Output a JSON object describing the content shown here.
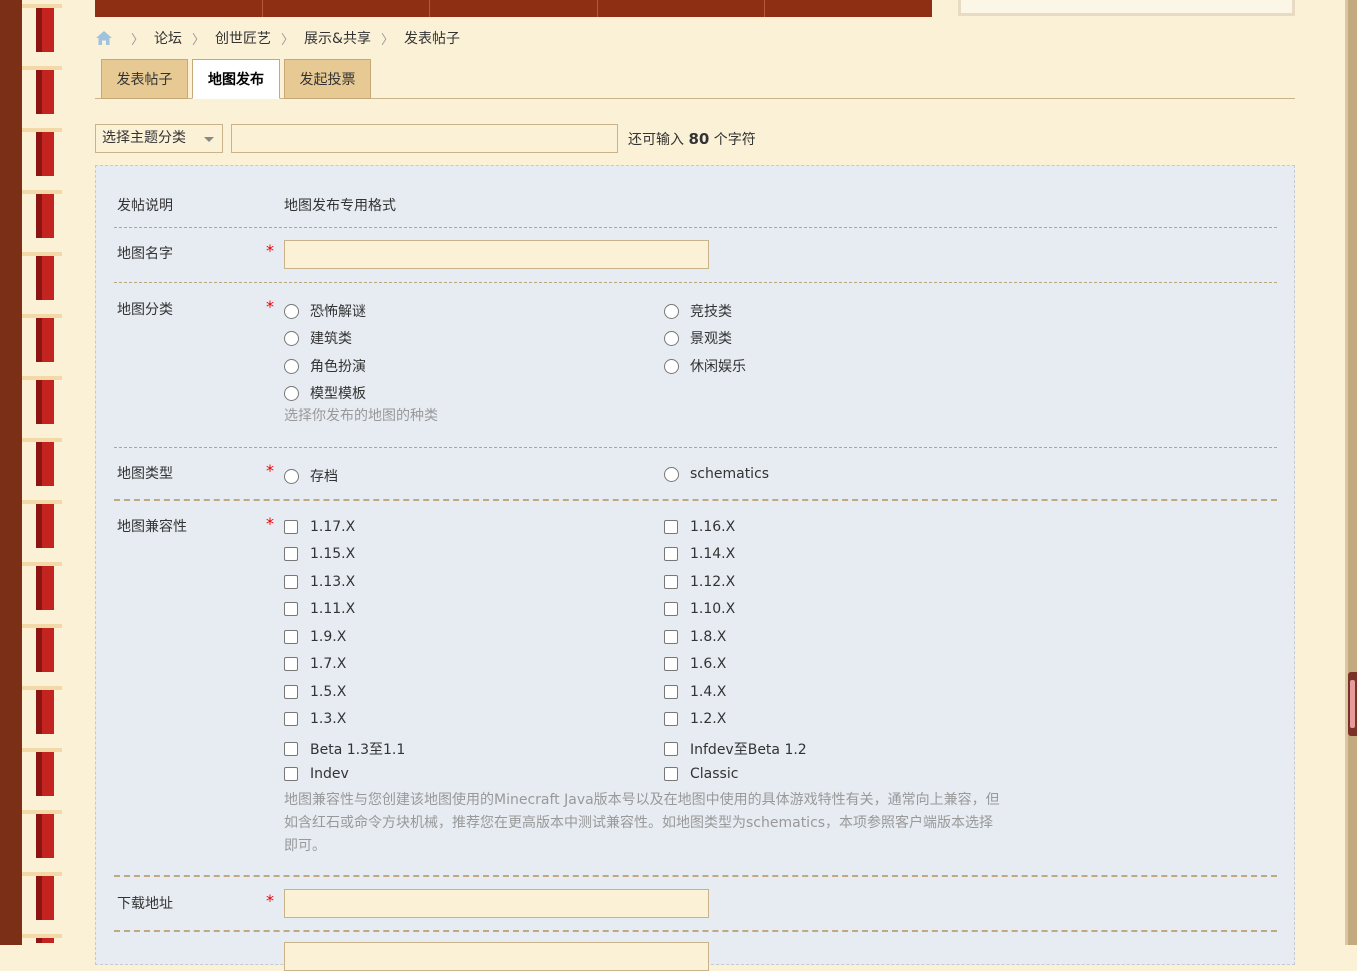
{
  "breadcrumb": {
    "items": [
      "论坛",
      "创世匠艺",
      "展示&共享",
      "发表帖子"
    ]
  },
  "tabs": [
    {
      "label": "发表帖子",
      "active": false
    },
    {
      "label": "地图发布",
      "active": true
    },
    {
      "label": "发起投票",
      "active": false
    }
  ],
  "subject": {
    "category_select": "选择主题分类",
    "title_value": "",
    "remain_prefix": "还可输入",
    "remain_count": "80",
    "remain_suffix": "个字符"
  },
  "form": {
    "intro_label": "发帖说明",
    "intro_value": "地图发布专用格式",
    "map_name_label": "地图名字",
    "required_mark": "*",
    "category_label": "地图分类",
    "category_options": [
      "恐怖解谜",
      "竞技类",
      "建筑类",
      "景观类",
      "角色扮演",
      "休闲娱乐",
      "模型模板"
    ],
    "category_hint": "选择你发布的地图的种类",
    "type_label": "地图类型",
    "type_options": [
      "存档",
      "schematics"
    ],
    "compat_label": "地图兼容性",
    "compat_options": [
      "1.17.X",
      "1.16.X",
      "1.15.X",
      "1.14.X",
      "1.13.X",
      "1.12.X",
      "1.11.X",
      "1.10.X",
      "1.9.X",
      "1.8.X",
      "1.7.X",
      "1.6.X",
      "1.5.X",
      "1.4.X",
      "1.3.X",
      "1.2.X",
      "Beta 1.3至1.1",
      "Infdev至Beta 1.2",
      "Indev",
      "Classic"
    ],
    "compat_hint_1": "地图兼容性与您创建该地图使用的Minecraft Java版本号以及在地图中使用的具体游戏特性有关，通常向上兼容，但",
    "compat_hint_2": "如含红石或命令方块机械，推荐您在更高版本中测试兼容性。如地图类型为schematics，本项参照客户端版本选择",
    "compat_hint_3": "即可。",
    "download_label": "下载地址"
  },
  "colors": {
    "nav": "#8e2f14",
    "tab": "#e7c993",
    "panel": "#e6ecf2",
    "required": "#ee0000"
  }
}
